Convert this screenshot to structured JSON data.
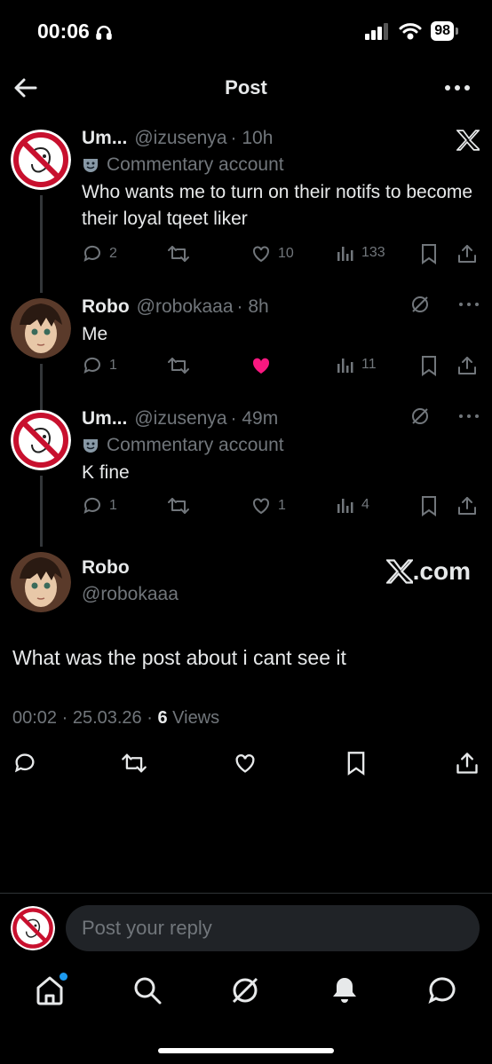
{
  "status_bar": {
    "time": "00:06",
    "battery": "98"
  },
  "header": {
    "title": "Post"
  },
  "posts": [
    {
      "name": "Um...",
      "handle": "@izusenya",
      "time": "· 10h",
      "badge": "Commentary account",
      "text": "Who wants me to turn on their notifs to become their loyal tqeet liker",
      "replies": "2",
      "likes": "10",
      "views": "133"
    },
    {
      "name": "Robo",
      "handle": "@robokaaa",
      "time": "· 8h",
      "text": "Me",
      "replies": "1",
      "likes": "",
      "views": "11"
    },
    {
      "name": "Um...",
      "handle": "@izusenya",
      "time": "· 49m",
      "badge": "Commentary account",
      "text": "K fine",
      "replies": "1",
      "likes": "1",
      "views": "4"
    }
  ],
  "main_post": {
    "name": "Robo",
    "handle": "@robokaaa",
    "brand": ".com",
    "text": "What was the post about i cant see it",
    "timestamp": "00:02 · 25.03.26 ·",
    "views_count": "6",
    "views_label": "Views"
  },
  "reply_bar": {
    "placeholder": "Post your reply"
  },
  "colors": {
    "like_active": "#f91880",
    "accent": "#1d9bf0",
    "muted": "#71767b"
  }
}
